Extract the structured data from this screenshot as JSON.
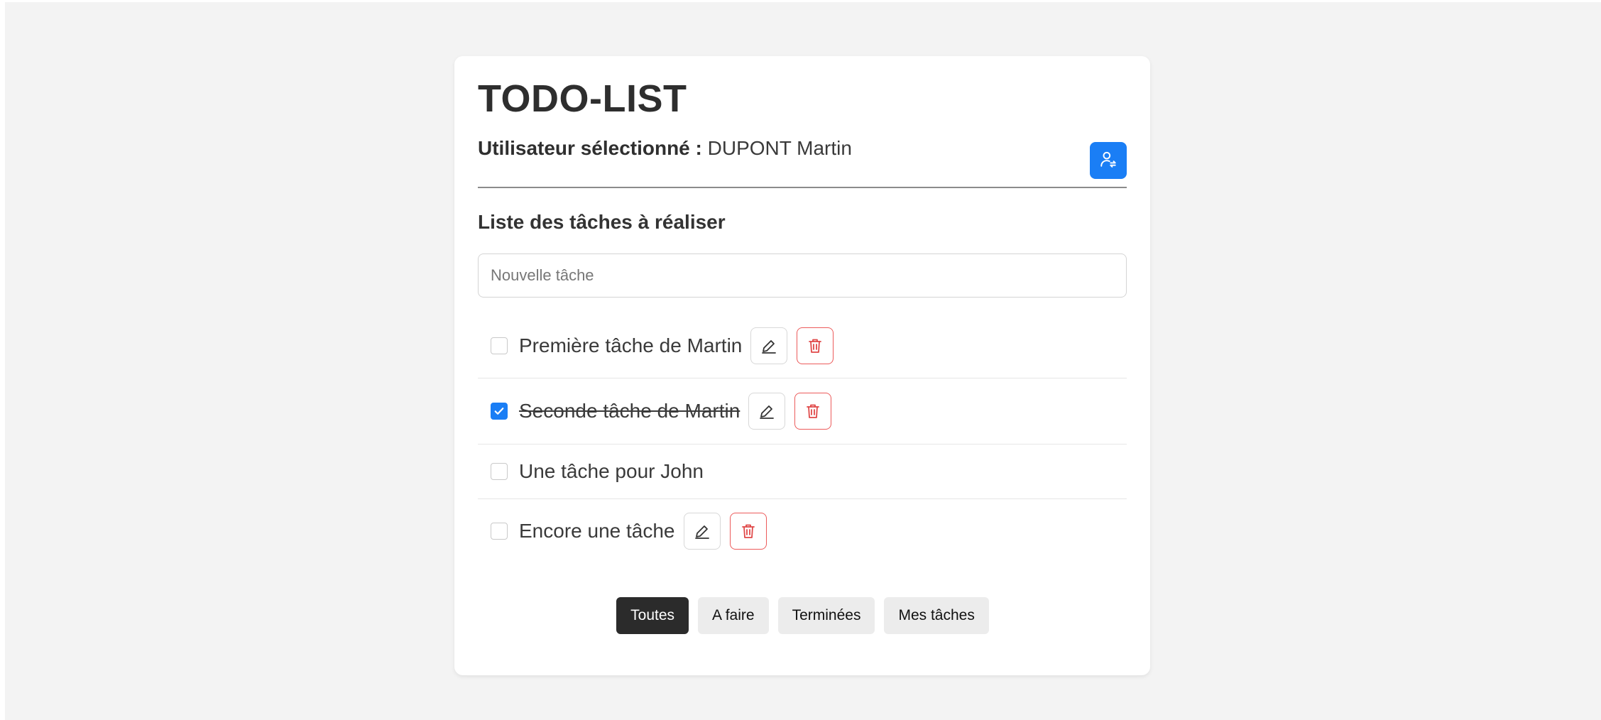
{
  "app": {
    "title": "TODO-LIST"
  },
  "user": {
    "label": "Utilisateur sélectionné :",
    "name": "DUPONT Martin",
    "switch_icon": "user-switch-icon"
  },
  "tasks_section": {
    "title": "Liste des tâches à réaliser",
    "new_task_placeholder": "Nouvelle tâche",
    "new_task_value": ""
  },
  "tasks": [
    {
      "label": "Première tâche de Martin",
      "done": false,
      "editable": true
    },
    {
      "label": "Seconde tâche de Martin",
      "done": true,
      "editable": true
    },
    {
      "label": "Une tâche pour John",
      "done": false,
      "editable": false
    },
    {
      "label": "Encore une tâche",
      "done": false,
      "editable": true
    }
  ],
  "filters": [
    {
      "label": "Toutes",
      "active": true
    },
    {
      "label": "A faire",
      "active": false
    },
    {
      "label": "Terminées",
      "active": false
    },
    {
      "label": "Mes tâches",
      "active": false
    }
  ],
  "colors": {
    "accent": "#1a7ef5",
    "danger": "#ec5b5b",
    "active_filter": "#2b2b2b",
    "page_background": "#f3f3f3"
  }
}
